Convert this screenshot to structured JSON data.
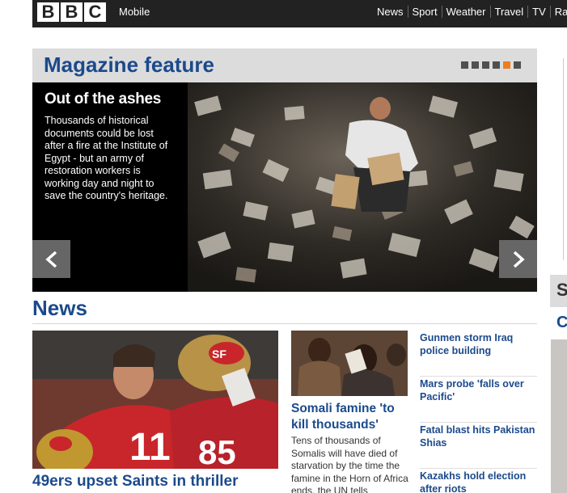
{
  "header": {
    "logo_letters": [
      "B",
      "B",
      "C"
    ],
    "mobile_label": "Mobile",
    "nav": [
      "News",
      "Sport",
      "Weather",
      "Travel",
      "TV",
      "Ra"
    ]
  },
  "magazine": {
    "title": "Magazine feature",
    "pager": {
      "count": 6,
      "active_index": 4
    },
    "feature": {
      "heading": "Out of the ashes",
      "body": "Thousands of historical documents could be lost after a fire at the Institute of Egypt - but an army of restoration workers is working day and night to save the country's heritage."
    }
  },
  "right_column": {
    "letter_s": "S",
    "letter_c": "C"
  },
  "news": {
    "title": "News",
    "lead_story": {
      "headline": "49ers upset Saints in thriller"
    },
    "second_story": {
      "headline": "Somali famine 'to kill thousands'",
      "body": "Tens of thousands of Somalis will have died of starvation by the time the famine in the Horn of Africa ends, the UN tells"
    },
    "side_stories": [
      "Gunmen storm Iraq police building",
      "Mars probe 'falls over Pacific'",
      "Fatal blast hits Pakistan Shias",
      "Kazakhs hold election after riots"
    ]
  },
  "colors": {
    "brand_blue": "#1b4a8c",
    "topbar": "#222222",
    "pager_active": "#ee7d1f",
    "pager_inactive": "#505050"
  }
}
